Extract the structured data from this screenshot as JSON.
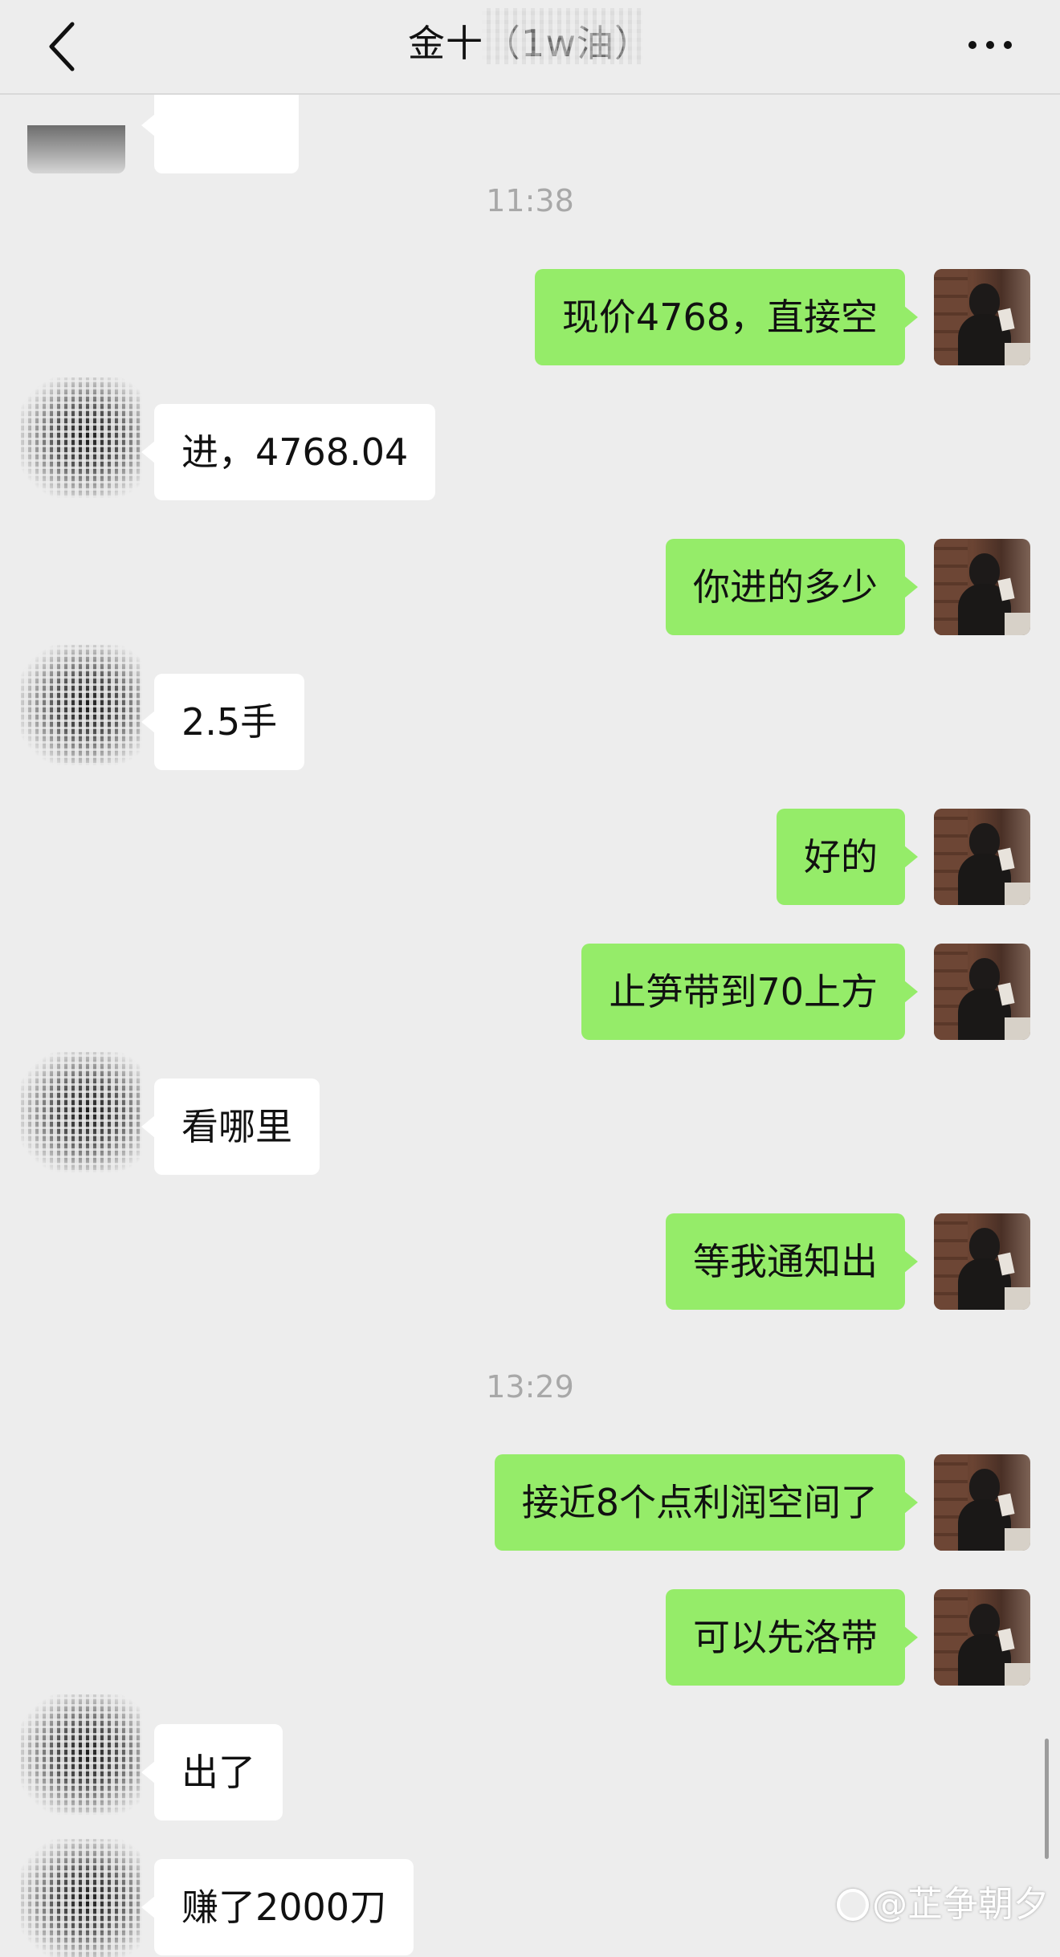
{
  "header": {
    "title": "金十（1w油）",
    "back_icon": "chevron-left-icon",
    "more_icon": "more-horizontal-icon"
  },
  "timestamps": [
    "11:38",
    "13:29"
  ],
  "messages": [
    {
      "sender": "self",
      "text": "现价4768，直接空"
    },
    {
      "sender": "other",
      "text": "进，4768.04"
    },
    {
      "sender": "self",
      "text": "你进的多少"
    },
    {
      "sender": "other",
      "text": "2.5手"
    },
    {
      "sender": "self",
      "text": "好的"
    },
    {
      "sender": "self",
      "text": "止笋带到70上方"
    },
    {
      "sender": "other",
      "text": "看哪里"
    },
    {
      "sender": "self",
      "text": "等我通知出"
    },
    {
      "sender": "self",
      "text": "接近8个点利润空间了"
    },
    {
      "sender": "self",
      "text": "可以先洛带"
    },
    {
      "sender": "other",
      "text": "出了"
    },
    {
      "sender": "other",
      "text": "赚了2000刀"
    }
  ],
  "watermark": "@芷争朝夕",
  "colors": {
    "background": "#ededed",
    "self_bubble": "#95ec69",
    "other_bubble": "#ffffff",
    "timestamp": "#a8a8a8"
  }
}
